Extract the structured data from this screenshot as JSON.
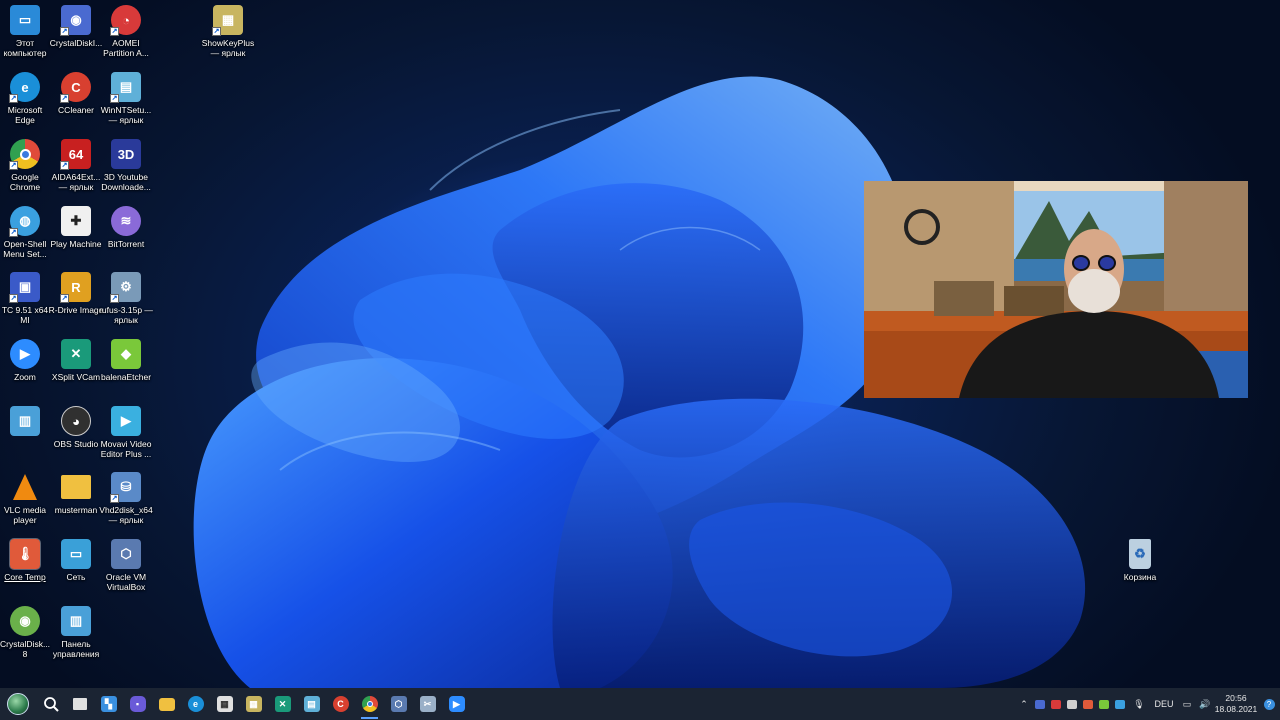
{
  "desktop": {
    "icons": [
      {
        "label": "Этот компьютер",
        "icon": "computer-icon",
        "color": "#2a8ad8"
      },
      {
        "label": "CrystalDiskI...",
        "icon": "crystaldisk-icon",
        "color": "#4a6ad0"
      },
      {
        "label": "AOMEI Partition A...",
        "icon": "aomei-icon",
        "color": "#d83a3a"
      },
      {
        "label": "ShowKeyPlus — ярлык",
        "icon": "showkeyplus-icon",
        "color": "#c8b560"
      },
      {
        "label": "Microsoft Edge",
        "icon": "edge-icon",
        "color": "#1a8fd8"
      },
      {
        "label": "CCleaner",
        "icon": "ccleaner-icon",
        "color": "#d84030"
      },
      {
        "label": "WinNTSetu... — ярлык",
        "icon": "winntsetup-icon",
        "color": "#5fb0d8"
      },
      {
        "label": "Google Chrome",
        "icon": "chrome-icon",
        "color": "#e04a3a"
      },
      {
        "label": "AIDA64Ext... — ярлык",
        "icon": "aida64-icon",
        "color": "#c82020"
      },
      {
        "label": "3D Youtube Downloade...",
        "icon": "3d-youtube-icon",
        "color": "#2a3a9a"
      },
      {
        "label": "Open-Shell Menu Set...",
        "icon": "openshell-icon",
        "color": "#3aa0e0"
      },
      {
        "label": "Play Machine",
        "icon": "gamepad-icon",
        "color": "#f0f0f0"
      },
      {
        "label": "BitTorrent",
        "icon": "bittorrent-icon",
        "color": "#8a6ad8"
      },
      {
        "label": "TC 9.51 x64 MI",
        "icon": "total-commander-icon",
        "color": "#3a5ac8"
      },
      {
        "label": "R-Drive Image",
        "icon": "rdrive-icon",
        "color": "#e0a020"
      },
      {
        "label": "rufus-3.15p — ярлык",
        "icon": "rufus-icon",
        "color": "#7a9ab8"
      },
      {
        "label": "Zoom",
        "icon": "zoom-icon",
        "color": "#2d8cff"
      },
      {
        "label": "XSplit VCam",
        "icon": "xsplit-icon",
        "color": "#1a9a7a"
      },
      {
        "label": "balenaEtcher",
        "icon": "etcher-icon",
        "color": "#7ac83a"
      },
      {
        "label": "",
        "icon": "control-panel-icon",
        "color": "#4aa0d8"
      },
      {
        "label": "OBS Studio",
        "icon": "obs-icon",
        "color": "#303030"
      },
      {
        "label": "Movavi Video Editor Plus ...",
        "icon": "movavi-icon",
        "color": "#3ab0e0"
      },
      {
        "label": "VLC media player",
        "icon": "vlc-icon",
        "color": "#f08a10"
      },
      {
        "label": "musterman",
        "icon": "folder-icon",
        "color": "#f0c040"
      },
      {
        "label": "Vhd2disk_x64 — ярлык",
        "icon": "vhd2disk-icon",
        "color": "#5a8ac8"
      },
      {
        "label": "Core Temp",
        "icon": "coretemp-icon",
        "color": "#e05a3a"
      },
      {
        "label": "Сеть",
        "icon": "network-icon",
        "color": "#3aa0d8"
      },
      {
        "label": "Oracle VM VirtualBox",
        "icon": "virtualbox-icon",
        "color": "#5a7ab0"
      },
      {
        "label": "CrystalDisk... 8",
        "icon": "crystaldisk-8-icon",
        "color": "#6ab04a"
      },
      {
        "label": "Панель управления",
        "icon": "control-panel-icon",
        "color": "#4aa0d8"
      },
      {
        "label": "Корзина",
        "icon": "recycle-bin-icon",
        "color": "#bcd0e0"
      }
    ]
  },
  "taskbar": {
    "apps": [
      {
        "name": "start",
        "icon": "start-orb-icon",
        "color": "#3a8a4a"
      },
      {
        "name": "search",
        "icon": "search-icon",
        "color": "#1b2433"
      },
      {
        "name": "task-view",
        "icon": "task-view-icon",
        "color": "#e0e0e0"
      },
      {
        "name": "widgets",
        "icon": "widgets-icon",
        "color": "#3a90e0"
      },
      {
        "name": "chat",
        "icon": "chat-icon",
        "color": "#6a5ad8"
      },
      {
        "name": "explorer",
        "icon": "folder-icon",
        "color": "#f0c040"
      },
      {
        "name": "edge",
        "icon": "edge-icon",
        "color": "#1a8fd8"
      },
      {
        "name": "store",
        "icon": "store-icon",
        "color": "#e0e0e0"
      },
      {
        "name": "showkeyplus",
        "icon": "showkeyplus-icon",
        "color": "#c8b560"
      },
      {
        "name": "xsplit",
        "icon": "xsplit-icon",
        "color": "#1a9a7a"
      },
      {
        "name": "winntsetup",
        "icon": "winntsetup-icon",
        "color": "#5fb0d8"
      },
      {
        "name": "ccleaner",
        "icon": "ccleaner-icon",
        "color": "#d84030"
      },
      {
        "name": "chrome",
        "icon": "chrome-icon",
        "color": "#e04a3a"
      },
      {
        "name": "virtualbox",
        "icon": "virtualbox-icon",
        "color": "#5a7ab0"
      },
      {
        "name": "snipping",
        "icon": "snipping-icon",
        "color": "#9ab0c8"
      },
      {
        "name": "zoom",
        "icon": "zoom-icon",
        "color": "#2d8cff"
      }
    ],
    "tray": {
      "language": "DEU",
      "time": "20:56",
      "date": "18.08.2021"
    }
  }
}
